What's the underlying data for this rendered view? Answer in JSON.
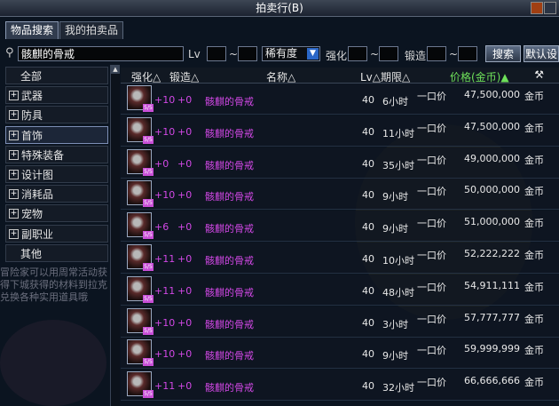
{
  "window": {
    "title": "拍卖行(B)"
  },
  "tabs": [
    {
      "label": "物品搜索",
      "active": true
    },
    {
      "label": "我的拍卖品",
      "active": false
    }
  ],
  "search": {
    "query": "骸麒的骨戒",
    "lv_label": "Lv",
    "lv_min": "",
    "lv_max": "",
    "tilde": "~",
    "rarity_selected": "稀有度",
    "enhance_label": "强化",
    "enhance_min": "",
    "enhance_max": "",
    "forge_label": "锻造",
    "forge_min": "",
    "forge_max": "",
    "search_button": "搜索",
    "default_button": "默认设"
  },
  "sidebar": {
    "items": [
      {
        "label": "全部",
        "expandable": false,
        "selected": false
      },
      {
        "label": "武器",
        "expandable": true,
        "selected": false
      },
      {
        "label": "防具",
        "expandable": true,
        "selected": false
      },
      {
        "label": "首饰",
        "expandable": true,
        "selected": true
      },
      {
        "label": "特殊装备",
        "expandable": true,
        "selected": false
      },
      {
        "label": "设计图",
        "expandable": true,
        "selected": false
      },
      {
        "label": "消耗品",
        "expandable": true,
        "selected": false
      },
      {
        "label": "宠物",
        "expandable": true,
        "selected": false
      },
      {
        "label": "副职业",
        "expandable": true,
        "selected": false
      },
      {
        "label": "其他",
        "expandable": false,
        "selected": false
      }
    ],
    "tip_text": "冒险家可以用周常活动获得下城获得的材料到拉克兑换各种实用道具哦"
  },
  "table": {
    "headers": {
      "enhance": "强化△",
      "forge": "锻造△",
      "name": "名称△",
      "lv_period": "Lv△期限△",
      "price": "价格(金币)▲"
    },
    "rows": [
      {
        "qty": "5/5",
        "enhance": "+10",
        "forge": "+0",
        "name": "骸麒的骨戒",
        "lv": "40",
        "period": "6小时",
        "type": "一口价",
        "price": "47,500,000",
        "currency": "金币"
      },
      {
        "qty": "5/5",
        "enhance": "+10",
        "forge": "+0",
        "name": "骸麒的骨戒",
        "lv": "40",
        "period": "11小时",
        "type": "一口价",
        "price": "47,500,000",
        "currency": "金币"
      },
      {
        "qty": "5/5",
        "enhance": "+0",
        "forge": "+0",
        "name": "骸麒的骨戒",
        "lv": "40",
        "period": "35小时",
        "type": "一口价",
        "price": "49,000,000",
        "currency": "金币"
      },
      {
        "qty": "5/5",
        "enhance": "+10",
        "forge": "+0",
        "name": "骸麒的骨戒",
        "lv": "40",
        "period": "9小时",
        "type": "一口价",
        "price": "50,000,000",
        "currency": "金币"
      },
      {
        "qty": "5/5",
        "enhance": "+6",
        "forge": "+0",
        "name": "骸麒的骨戒",
        "lv": "40",
        "period": "9小时",
        "type": "一口价",
        "price": "51,000,000",
        "currency": "金币"
      },
      {
        "qty": "5/5",
        "enhance": "+11",
        "forge": "+0",
        "name": "骸麒的骨戒",
        "lv": "40",
        "period": "10小时",
        "type": "一口价",
        "price": "52,222,222",
        "currency": "金币"
      },
      {
        "qty": "5/5",
        "enhance": "+11",
        "forge": "+0",
        "name": "骸麒的骨戒",
        "lv": "40",
        "period": "48小时",
        "type": "一口价",
        "price": "54,911,111",
        "currency": "金币"
      },
      {
        "qty": "5/5",
        "enhance": "+10",
        "forge": "+0",
        "name": "骸麒的骨戒",
        "lv": "40",
        "period": "3小时",
        "type": "一口价",
        "price": "57,777,777",
        "currency": "金币"
      },
      {
        "qty": "5/5",
        "enhance": "+10",
        "forge": "+0",
        "name": "骸麒的骨戒",
        "lv": "40",
        "period": "9小时",
        "type": "一口价",
        "price": "59,999,999",
        "currency": "金币"
      },
      {
        "qty": "5/5",
        "enhance": "+11",
        "forge": "+0",
        "name": "骸麒的骨戒",
        "lv": "40",
        "period": "32小时",
        "type": "一口价",
        "price": "66,666,666",
        "currency": "金币"
      }
    ]
  },
  "colors": {
    "enhance_text": "#d248e6",
    "price_header": "#6ee05a"
  }
}
